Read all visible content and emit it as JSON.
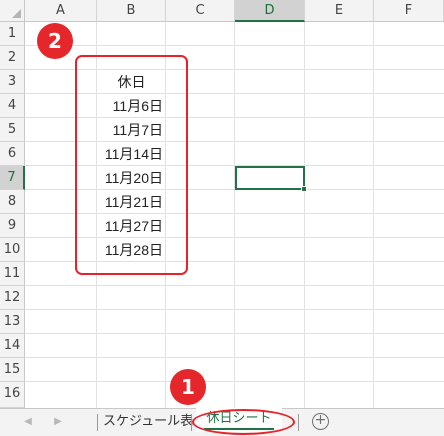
{
  "spreadsheet": {
    "column_headers": [
      "A",
      "B",
      "C",
      "D",
      "E",
      "F"
    ],
    "row_headers": [
      "1",
      "2",
      "3",
      "4",
      "5",
      "6",
      "7",
      "8",
      "9",
      "10",
      "11",
      "12",
      "13",
      "14",
      "15",
      "16"
    ],
    "selected_column": "D",
    "selected_row": "7",
    "active_cell": "D7",
    "cells": {
      "B3": "休日",
      "B4": "11月6日",
      "B5": "11月7日",
      "B6": "11月14日",
      "B7": "11月20日",
      "B8": "11月21日",
      "B9": "11月27日",
      "B10": "11月28日"
    },
    "accent_color": "#217346"
  },
  "annotations": {
    "badge_1": "1",
    "badge_2": "2",
    "color": "#e5262b"
  },
  "sheet_tabs": {
    "tabs": [
      "スケジュール表",
      "休日シート"
    ],
    "active_tab": "休日シート",
    "prev_icon": "triangle-left-icon",
    "next_icon": "triangle-right-icon",
    "add_icon": "plus-circle-icon",
    "add_symbol": "+"
  }
}
